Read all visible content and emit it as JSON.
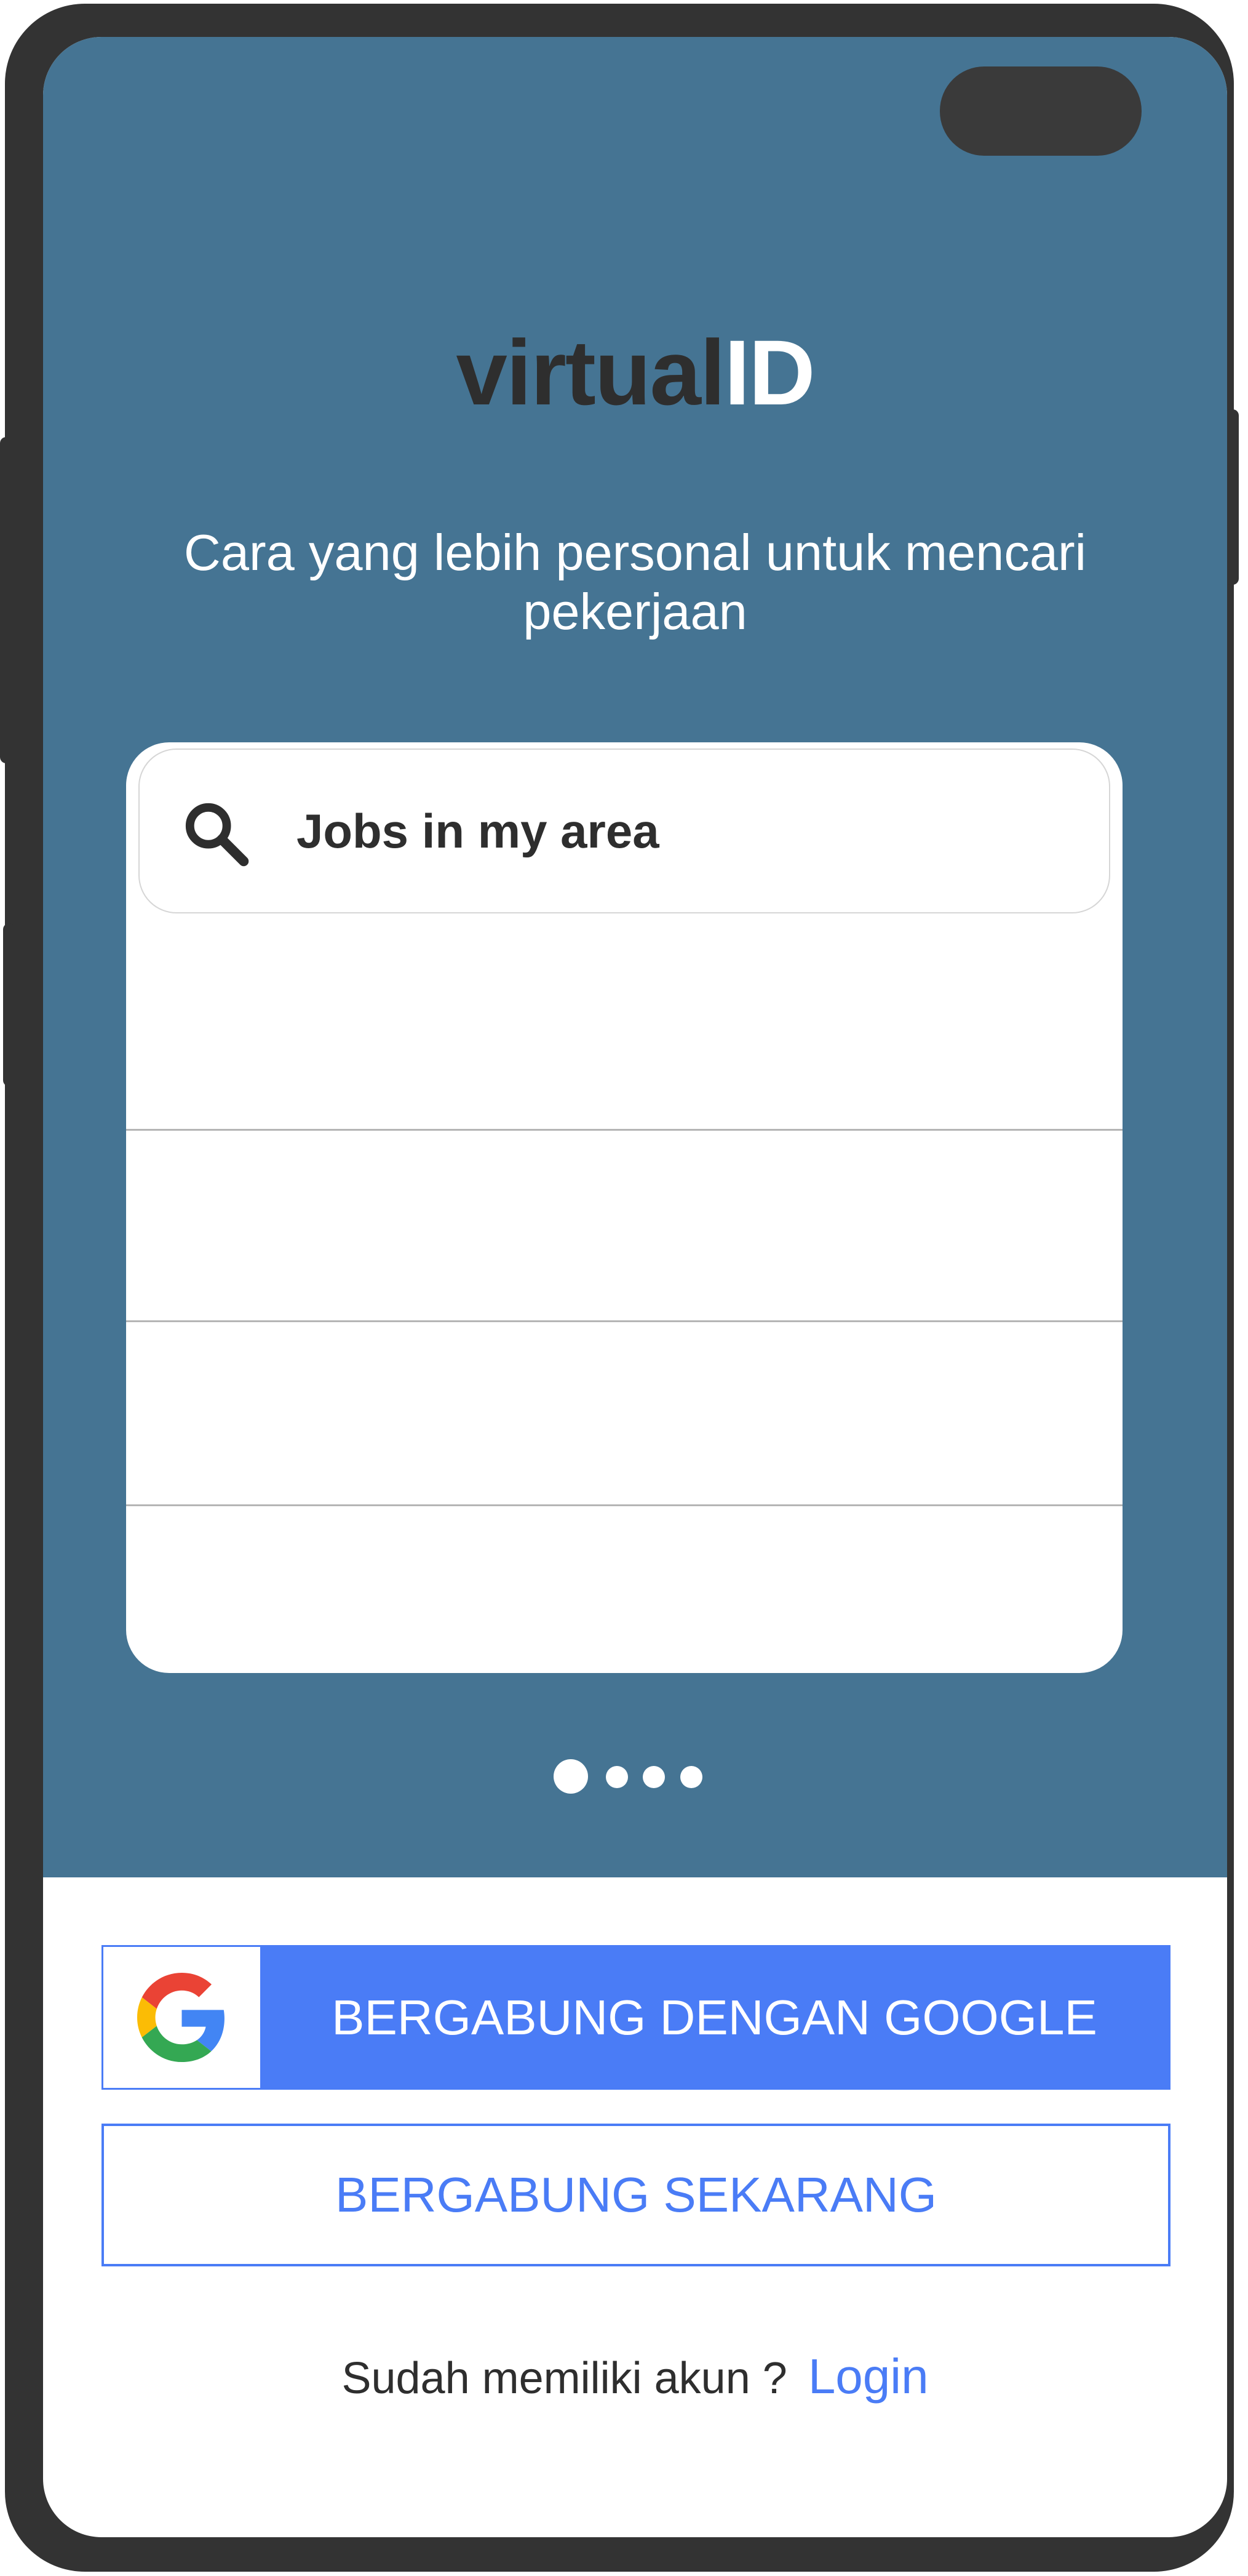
{
  "app": {
    "logo_part1": "virtual",
    "logo_part2": "ID",
    "tagline": "Cara yang lebih personal untuk mencari pekerjaan"
  },
  "search": {
    "label": "Jobs in my area",
    "icon": "search-icon"
  },
  "carousel": {
    "page_count": 4,
    "active_index": 0
  },
  "actions": {
    "google_button_label": "BERGABUNG DENGAN GOOGLE",
    "google_icon": "google-logo-icon",
    "join_button_label": "BERGABUNG SEKARANG",
    "login_prompt": "Sudah memiliki akun ?",
    "login_link": "Login"
  },
  "colors": {
    "hero_background": "#457493",
    "accent_blue": "#4a7cf6",
    "text_dark": "#2e2e2e",
    "phone_frame": "#333333"
  }
}
